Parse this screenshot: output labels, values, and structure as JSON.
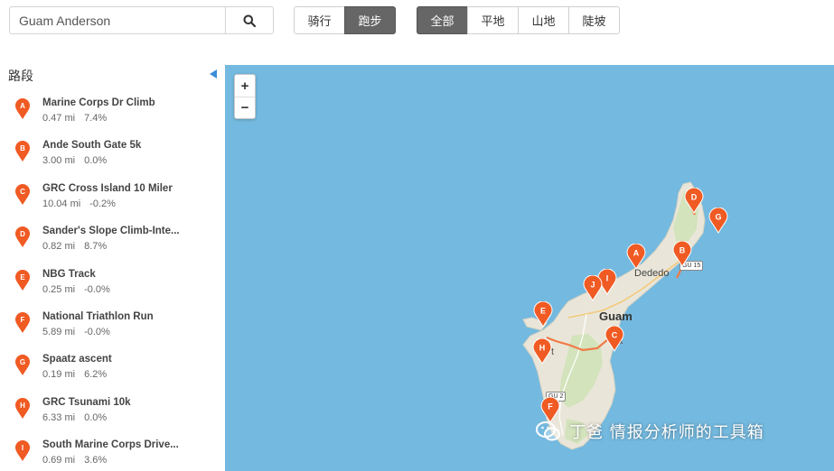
{
  "search": {
    "value": "Guam Anderson",
    "icon": "search-icon"
  },
  "sport_toggle": [
    {
      "label": "骑行",
      "active": false
    },
    {
      "label": "跑步",
      "active": true
    }
  ],
  "terrain_toggle": [
    {
      "label": "全部",
      "active": true
    },
    {
      "label": "平地",
      "active": false
    },
    {
      "label": "山地",
      "active": false
    },
    {
      "label": "陡坡",
      "active": false
    }
  ],
  "sidebar": {
    "title": "路段",
    "segments": [
      {
        "letter": "A",
        "name": "Marine Corps Dr Climb",
        "distance": "0.47 mi",
        "grade": "7.4%"
      },
      {
        "letter": "B",
        "name": "Ande South Gate 5k",
        "distance": "3.00 mi",
        "grade": "0.0%"
      },
      {
        "letter": "C",
        "name": "GRC Cross Island 10 Miler",
        "distance": "10.04 mi",
        "grade": "-0.2%"
      },
      {
        "letter": "D",
        "name": "Sander's Slope Climb-Inte...",
        "distance": "0.82 mi",
        "grade": "8.7%"
      },
      {
        "letter": "E",
        "name": "NBG Track",
        "distance": "0.25 mi",
        "grade": "-0.0%"
      },
      {
        "letter": "F",
        "name": "National Triathlon Run",
        "distance": "5.89 mi",
        "grade": "-0.0%"
      },
      {
        "letter": "G",
        "name": "Spaatz ascent",
        "distance": "0.19 mi",
        "grade": "6.2%"
      },
      {
        "letter": "H",
        "name": "GRC Tsunami 10k",
        "distance": "6.33 mi",
        "grade": "0.0%"
      },
      {
        "letter": "I",
        "name": "South Marine Corps Drive...",
        "distance": "0.69 mi",
        "grade": "3.6%"
      }
    ]
  },
  "map": {
    "zoom_in": "+",
    "zoom_out": "−",
    "labels": {
      "island": "Guam",
      "city": "Dededo",
      "partial_a": "a",
      "partial_t": "t"
    },
    "road_shields": {
      "route_15": "GU 15",
      "route_2": "GU 2"
    },
    "pins": [
      "A",
      "B",
      "C",
      "D",
      "E",
      "F",
      "G",
      "H",
      "I",
      "J"
    ],
    "colors": {
      "water": "#74b9df",
      "land": "#e9e6d9",
      "green": "#d3e3bc",
      "pin": "#f05a23",
      "route": "#f07a45"
    }
  },
  "watermark": {
    "text": "丁爸 情报分析师的工具箱"
  }
}
